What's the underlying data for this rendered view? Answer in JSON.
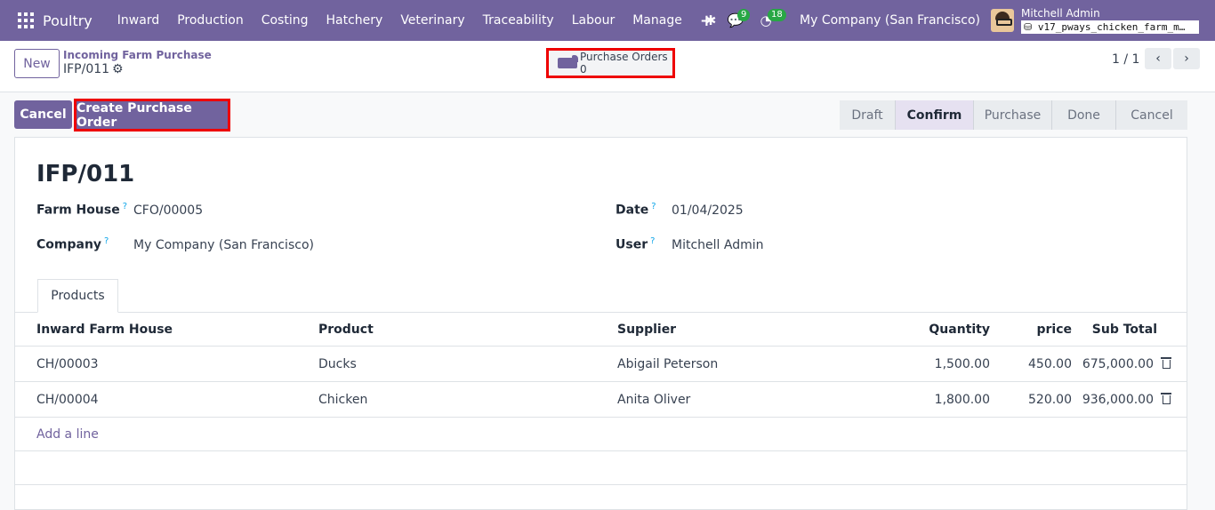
{
  "navbar": {
    "brand": "Poultry",
    "menu": [
      "Inward",
      "Production",
      "Costing",
      "Hatchery",
      "Veterinary",
      "Traceability",
      "Labour",
      "Manage"
    ],
    "plus": "+",
    "messages_count": "9",
    "activities_count": "18",
    "company": "My Company (San Francisco)",
    "user_name": "Mitchell Admin",
    "database": "v17_pways_chicken_farm_m…"
  },
  "control_panel": {
    "new_label": "New",
    "breadcrumb_parent": "Incoming Farm Purchase",
    "breadcrumb_current": "IFP/011",
    "smart_button_label": "Purchase Orders",
    "smart_button_count": "0",
    "pager": "1 / 1"
  },
  "actions": {
    "cancel_label": "Cancel",
    "create_po_label": "Create Purchase Order"
  },
  "statusbar": [
    "Draft",
    "Confirm",
    "Purchase",
    "Done",
    "Cancel"
  ],
  "statusbar_active": "Confirm",
  "form": {
    "title": "IFP/011",
    "farm_house_label": "Farm House",
    "farm_house": "CFO/00005",
    "company_label": "Company",
    "company": "My Company (San Francisco)",
    "date_label": "Date",
    "date": "01/04/2025",
    "user_label": "User",
    "user": "Mitchell Admin",
    "help_mark": "?"
  },
  "tabs": [
    "Products"
  ],
  "table": {
    "headers": [
      "Inward Farm House",
      "Product",
      "Supplier",
      "Quantity",
      "price",
      "Sub Total"
    ],
    "rows": [
      [
        "CH/00003",
        "Ducks",
        "Abigail Peterson",
        "1,500.00",
        "450.00",
        "675,000.00"
      ],
      [
        "CH/00004",
        "Chicken",
        "Anita Oliver",
        "1,800.00",
        "520.00",
        "936,000.00"
      ]
    ],
    "add_line": "Add a line"
  },
  "colors": {
    "brand": "#71639e",
    "highlight": "#e00000"
  }
}
